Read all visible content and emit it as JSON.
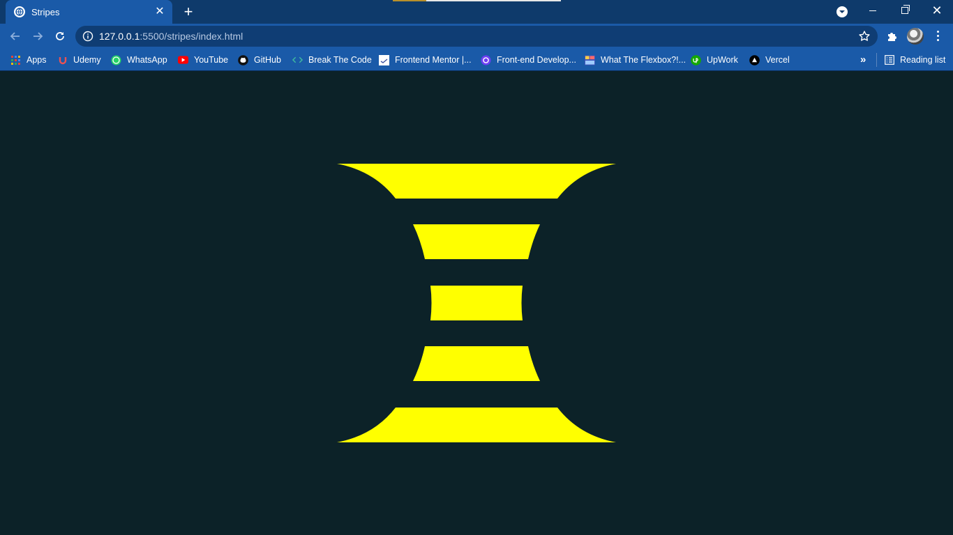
{
  "tab": {
    "title": "Stripes",
    "close_glyph": "✕",
    "favicon": "globe-icon"
  },
  "new_tab_glyph": "+",
  "window_controls": {
    "close_glyph": "✕"
  },
  "address": {
    "host": "127.0.0.1",
    "path": ":5500/stripes/index.html"
  },
  "bookmarks": [
    {
      "label": "Apps",
      "icon": "apps-grid-icon"
    },
    {
      "label": "Udemy",
      "icon": "udemy-icon"
    },
    {
      "label": "WhatsApp",
      "icon": "whatsapp-icon"
    },
    {
      "label": "YouTube",
      "icon": "youtube-icon"
    },
    {
      "label": "GitHub",
      "icon": "github-icon"
    },
    {
      "label": "Break The Code",
      "icon": "code-icon"
    },
    {
      "label": "Frontend Mentor |...",
      "icon": "frontend-mentor-icon"
    },
    {
      "label": "Front-end Develop...",
      "icon": "frontend-dev-icon"
    },
    {
      "label": "What The Flexbox?!...",
      "icon": "flexbox-icon"
    },
    {
      "label": "UpWork",
      "icon": "upwork-icon"
    },
    {
      "label": "Vercel",
      "icon": "vercel-icon"
    }
  ],
  "bookmarks_overflow_glyph": "»",
  "reading_list": {
    "label": "Reading list",
    "icon": "reading-list-icon"
  },
  "colors": {
    "page_background": "#0c2228",
    "stripe": "#ffff00",
    "chrome": "#1a5aa8",
    "titlebar": "#0e3a6b"
  }
}
